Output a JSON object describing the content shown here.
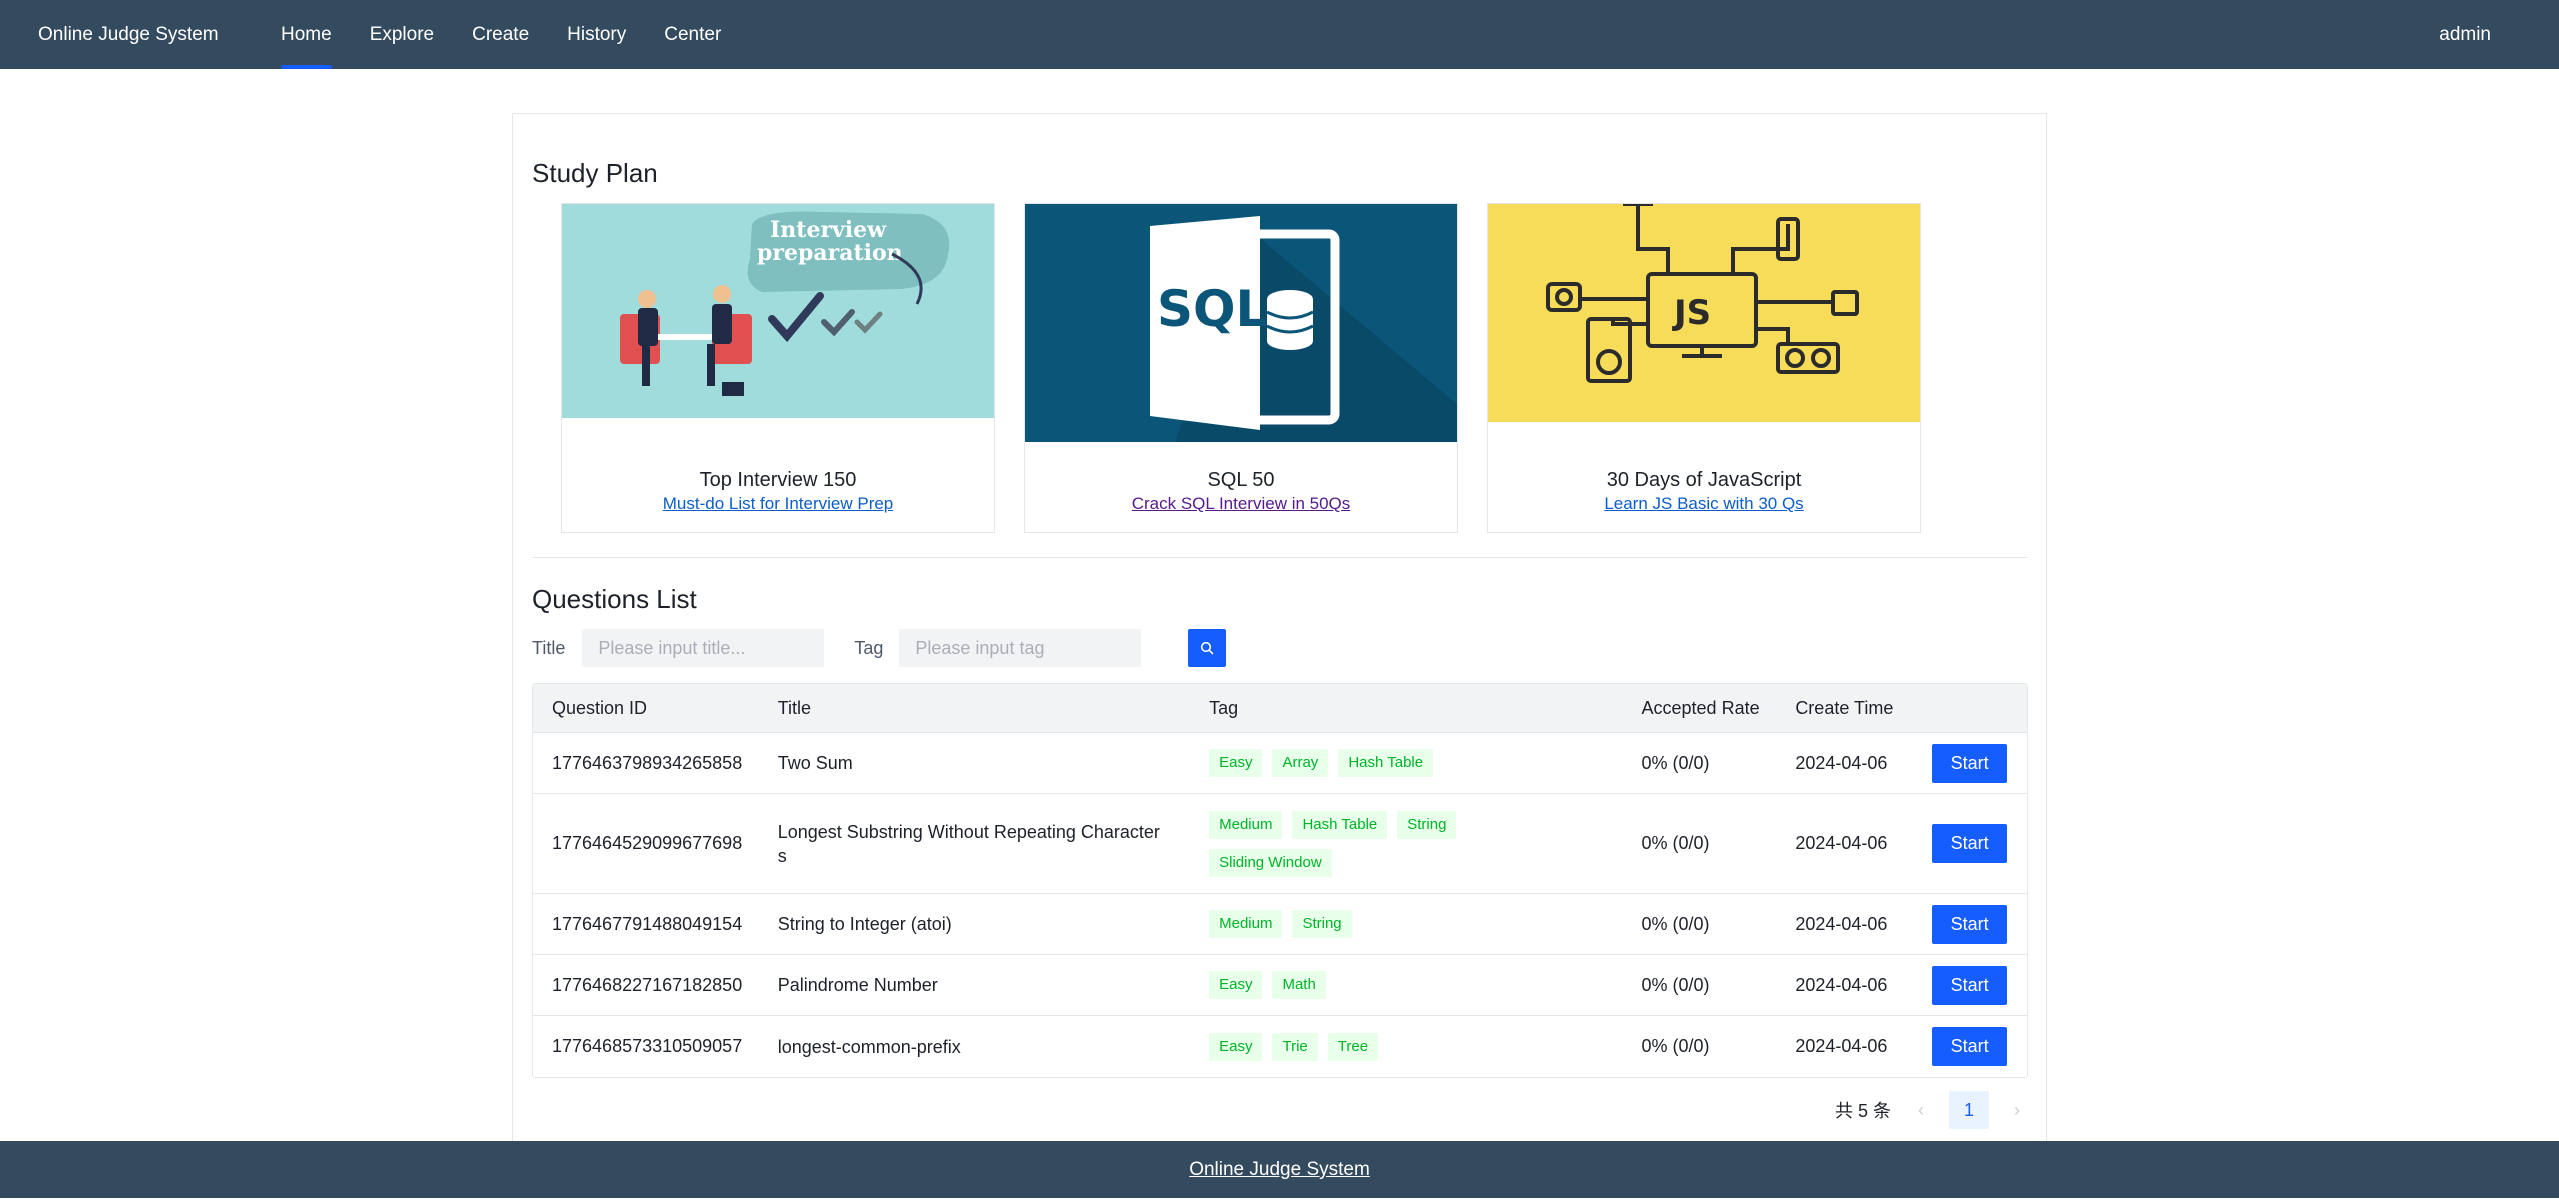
{
  "header": {
    "brand": "Online Judge System",
    "nav": [
      "Home",
      "Explore",
      "Create",
      "History",
      "Center"
    ],
    "user": "admin"
  },
  "study_plan": {
    "title": "Study Plan",
    "plans": [
      {
        "title": "Top Interview 150",
        "link": "Must-do List for Interview Prep",
        "cover_text": "Interview preparation",
        "link_color": "#0b5ec9"
      },
      {
        "title": "SQL 50",
        "link": "Crack SQL Interview in 50Qs",
        "cover_text": "SQL",
        "link_color": "#551a8b"
      },
      {
        "title": "30 Days of JavaScript",
        "link": "Learn JS Basic with 30 Qs",
        "cover_text": "JS",
        "link_color": "#0b5ec9"
      }
    ]
  },
  "questions": {
    "title": "Questions List",
    "search": {
      "title_label": "Title",
      "title_placeholder": "Please input title...",
      "tag_label": "Tag",
      "tag_placeholder": "Please input tag"
    },
    "columns": [
      "Question ID",
      "Title",
      "Tag",
      "Accepted Rate",
      "Create Time"
    ],
    "rows": [
      {
        "id": "1776463798934265858",
        "title": "Two Sum",
        "tags": [
          "Easy",
          "Array",
          "Hash Table"
        ],
        "rate": "0% (0/0)",
        "time": "2024-04-06",
        "action": "Start"
      },
      {
        "id": "1776464529099677698",
        "title": "Longest Substring Without Repeating Characters",
        "tags": [
          "Medium",
          "Hash Table",
          "String",
          "Sliding Window"
        ],
        "rate": "0% (0/0)",
        "time": "2024-04-06",
        "action": "Start"
      },
      {
        "id": "1776467791488049154",
        "title": "String to Integer (atoi)",
        "tags": [
          "Medium",
          "String"
        ],
        "rate": "0% (0/0)",
        "time": "2024-04-06",
        "action": "Start"
      },
      {
        "id": "1776468227167182850",
        "title": "Palindrome Number",
        "tags": [
          "Easy",
          "Math"
        ],
        "rate": "0% (0/0)",
        "time": "2024-04-06",
        "action": "Start"
      },
      {
        "id": "1776468573310509057",
        "title": "longest-common-prefix",
        "tags": [
          "Easy",
          "Trie",
          "Tree"
        ],
        "rate": "0% (0/0)",
        "time": "2024-04-06",
        "action": "Start"
      }
    ],
    "pagination": {
      "total": "共 5 条",
      "current": "1",
      "prev": "‹",
      "next": "›"
    }
  },
  "footer": {
    "text": "Online Judge System"
  },
  "colors": {
    "header_bg": "#344a5e",
    "primary": "#165dff",
    "tag_bg": "#e8ffea",
    "tag_text": "#00b42a"
  }
}
